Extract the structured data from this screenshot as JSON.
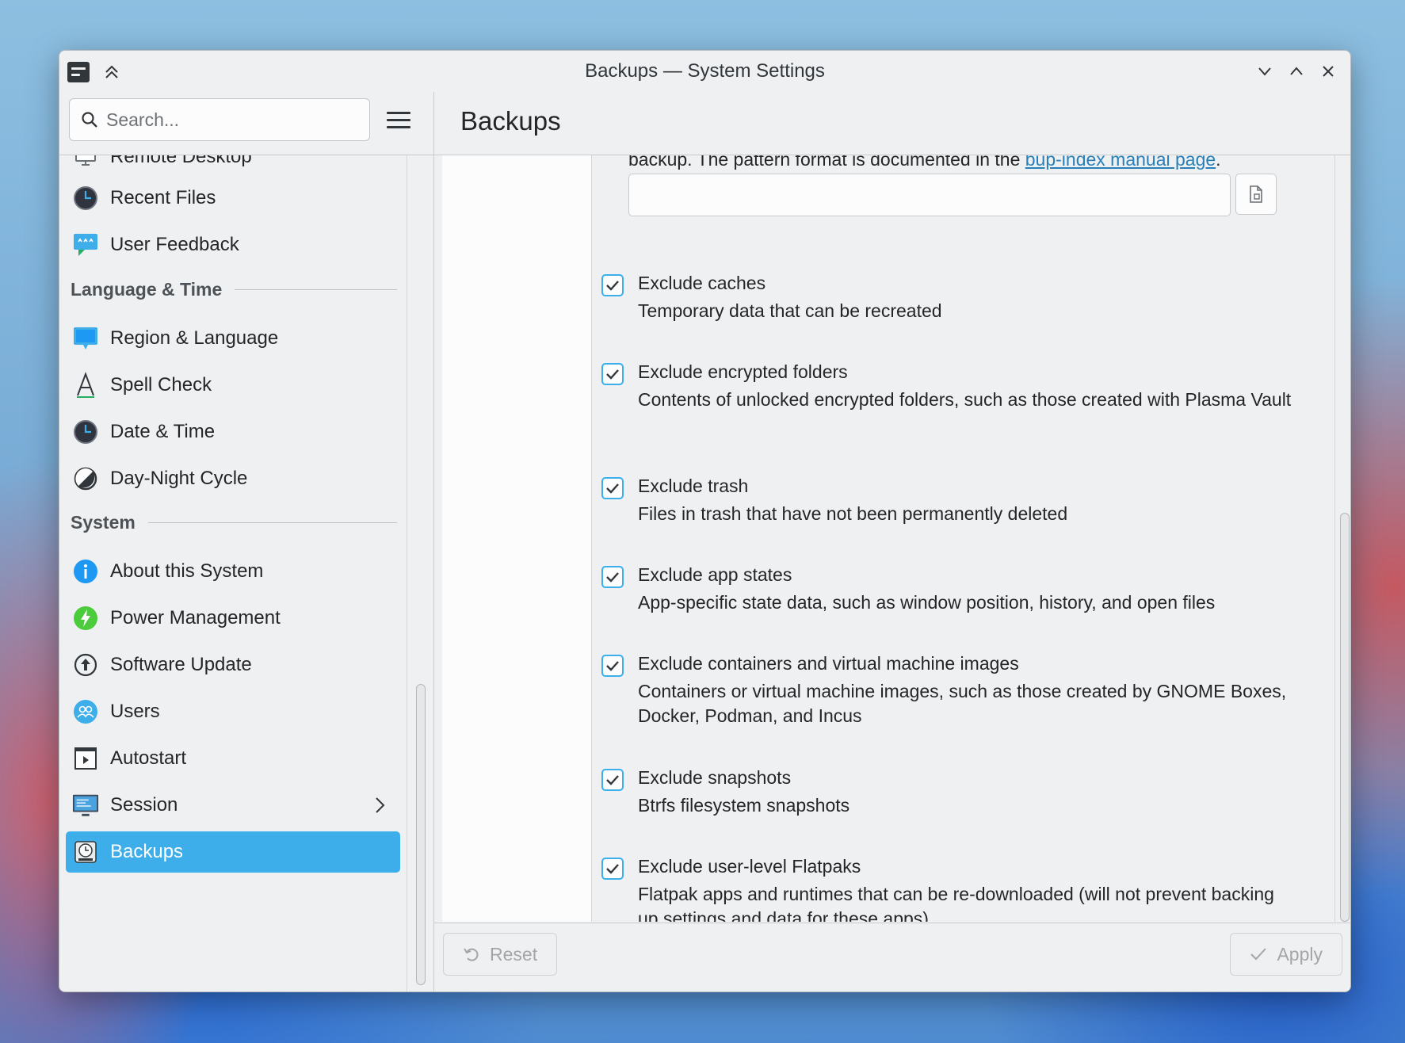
{
  "window": {
    "title": "Backups — System Settings"
  },
  "toolbar": {
    "search_placeholder": "Search...",
    "page_title": "Backups"
  },
  "sidebar": {
    "partial_item": "Remote Desktop",
    "items_top": [
      {
        "label": "Recent Files",
        "icon": "clock-icon"
      },
      {
        "label": "User Feedback",
        "icon": "feedback-icon"
      }
    ],
    "sections": [
      {
        "title": "Language & Time",
        "items": [
          {
            "label": "Region & Language",
            "icon": "region-icon"
          },
          {
            "label": "Spell Check",
            "icon": "spellcheck-icon"
          },
          {
            "label": "Date & Time",
            "icon": "clock-icon"
          },
          {
            "label": "Day-Night Cycle",
            "icon": "day-night-icon"
          }
        ]
      },
      {
        "title": "System",
        "items": [
          {
            "label": "About this System",
            "icon": "info-icon"
          },
          {
            "label": "Power Management",
            "icon": "power-icon"
          },
          {
            "label": "Software Update",
            "icon": "update-icon"
          },
          {
            "label": "Users",
            "icon": "users-icon"
          },
          {
            "label": "Autostart",
            "icon": "autostart-icon"
          },
          {
            "label": "Session",
            "icon": "session-icon"
          },
          {
            "label": "Backups",
            "icon": "backups-icon",
            "active": true
          }
        ]
      }
    ]
  },
  "main": {
    "top_note_text": "backup. The pattern format is documented in the ",
    "top_note_link": "bup-index manual page",
    "top_note_end": ".",
    "pattern_value": "",
    "options": [
      {
        "label": "Exclude caches",
        "checked": true,
        "description": "Temporary data that can be recreated"
      },
      {
        "label": "Exclude encrypted folders",
        "checked": true,
        "description": "Contents of unlocked encrypted folders, such as those created with Plasma Vault"
      },
      {
        "label": "Exclude trash",
        "checked": true,
        "description": "Files in trash that have not been permanently deleted"
      },
      {
        "label": "Exclude app states",
        "checked": true,
        "description": "App-specific state data, such as window position, history, and open files"
      },
      {
        "label": "Exclude containers and virtual machine images",
        "checked": true,
        "description": "Containers or virtual machine images, such as those created by GNOME Boxes, Docker, Podman, and Incus"
      },
      {
        "label": "Exclude snapshots",
        "checked": true,
        "description": "Btrfs filesystem snapshots"
      },
      {
        "label": "Exclude user-level Flatpaks",
        "checked": true,
        "description": "Flatpak apps and runtimes that can be re-downloaded (will not prevent backing up settings and data for these apps)"
      }
    ]
  },
  "footer": {
    "reset_label": "Reset",
    "apply_label": "Apply"
  },
  "colors": {
    "accent": "#3daee9",
    "link": "#2980b9",
    "window_bg": "#eff0f1"
  }
}
